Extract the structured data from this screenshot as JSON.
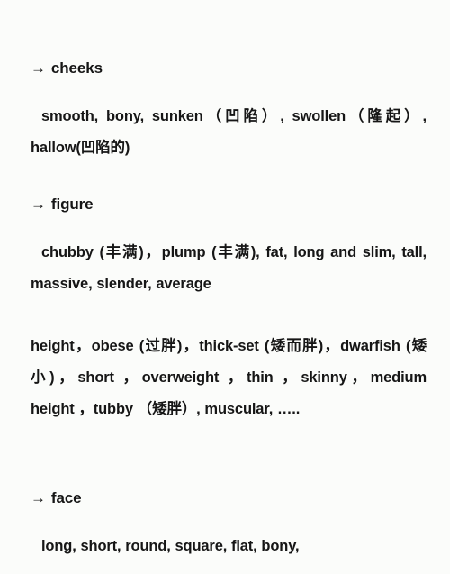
{
  "document": {
    "background_color": "#fbfcfa",
    "text_color": "#161616",
    "sections": [
      {
        "id": "cheeks",
        "arrow": "→",
        "heading": "cheeks",
        "body": "smooth, bony, sunken（凹陷）, swollen（隆起）, hallow(凹陷的)"
      },
      {
        "id": "figure",
        "arrow": "→",
        "heading": "figure",
        "body": "chubby (丰满)，plump (丰满), fat, long and slim, tall, massive, slender, average",
        "body_continued": "height，obese (过胖)，thick-set (矮而胖)，dwarfish (矮小)，short ，overweight ，thin ，skinny，medium height ，tubby （矮胖）, muscular, ….."
      },
      {
        "id": "face",
        "arrow": "→",
        "heading": "face",
        "body": "long, short, round, square, flat, bony,"
      }
    ]
  }
}
